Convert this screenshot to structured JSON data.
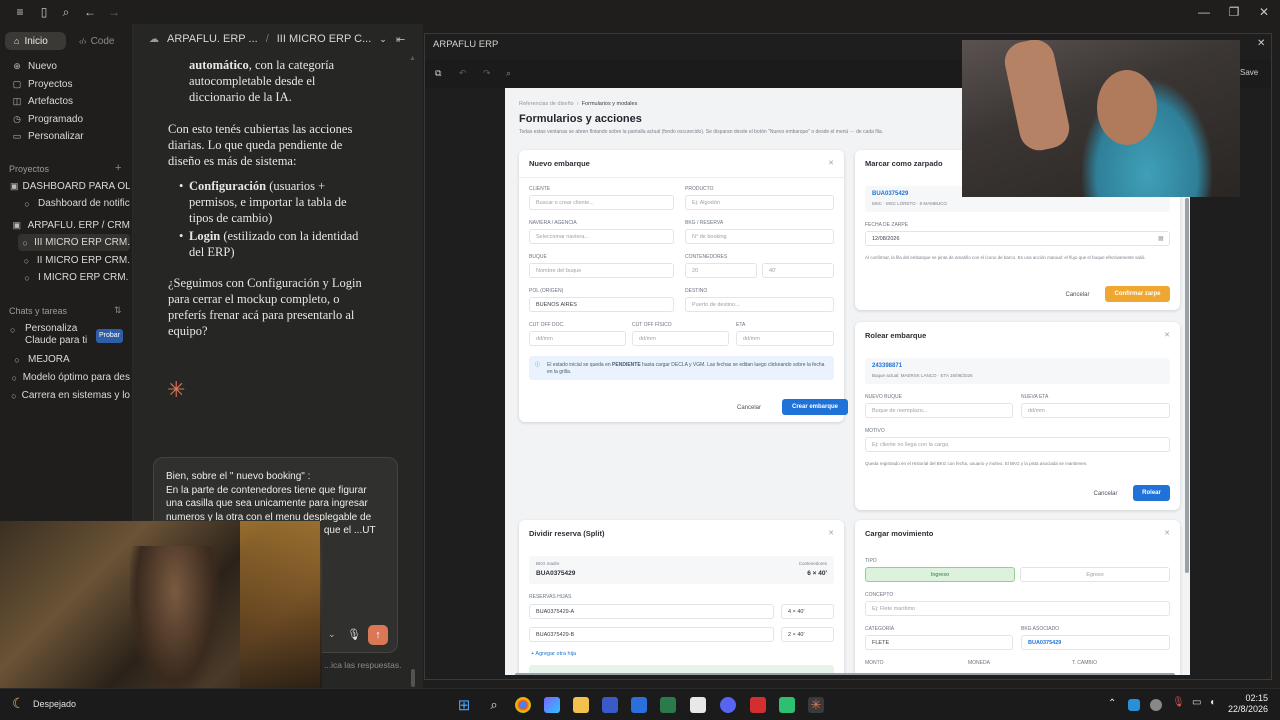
{
  "topbar": {
    "sidebar_toggle": "sidebar-icon",
    "search": "search-icon",
    "back": "←",
    "forward": "→"
  },
  "sidebar": {
    "tabs": {
      "home": "Inicio",
      "code": "Code"
    },
    "nav": [
      "Nuevo",
      "Proyectos",
      "Artefactos",
      "Programado",
      "Personalizar"
    ],
    "projects_title": "Proyectos",
    "projects": [
      "DASHBOARD PARA OLE",
      "Dashboard de notific",
      "ARPAFLU. ERP / CRM",
      "III MICRO ERP CRM.",
      "II MICRO ERP CRM.",
      "I MICRO ERP CRM."
    ],
    "chats_title": "Chats y tareas",
    "chats": [
      "Personaliza Claude para ti",
      "MEJORA",
      "Modelo óptimo para des",
      "Carrera en sistemas y lo"
    ],
    "probar": "Probar"
  },
  "chat": {
    "breadcrumb_a": "ARPAFLU. ERP ...",
    "breadcrumb_sep": "/",
    "breadcrumb_b": "III MICRO ERP C...",
    "p1_bold": "automático",
    "p1_rest": ", con la categoría autocompletable desde el diccionario de la IA.",
    "p2": "Con esto tenés cubiertas las acciones diarias. Lo que queda pendiente de diseño es más de sistema:",
    "b1_bold": "Configuración",
    "b1_rest": " (usuarios + permisos, e importar la tabla de tipos de cambio)",
    "b2_bold": "Login",
    "b2_rest": " (estilizado con la identidad del ERP)",
    "p3": "¿Seguimos con Configuración y Login para cerrar el mockup completo, o preferís frenar acá para presentarlo al equipo?",
    "composer_text": "Bien, sobre el \" nuevo booking\" :\nEn la parte de contenedores tiene que figurar una casilla que sea unicamente para ingresar numeros y la otra con el menu desplegable de ...os a agregar ...o tambien la ...eta que el ...UT OFF ...s tienen que ...ra, bkg,",
    "footer": "...ica las respuestas."
  },
  "window": {
    "title": "ARPAFLU ERP",
    "save": "Save",
    "crumb_a": "Referencias de diseño",
    "crumb_b": "Formularios y modales",
    "page_title": "Formularios y acciones",
    "page_sub": "Todas estas ventanas se abren flotando sobre la pantalla actual (fondo oscurecido). Se disparan desde el botón \"Nuevo embarque\" o desde el menú ··· de cada fila.",
    "nuevo": {
      "title": "Nuevo embarque",
      "cliente": "CLIENTE",
      "cliente_ph": "Buscar o crear cliente...",
      "producto": "PRODUCTO",
      "producto_ph": "Ej: Algodón",
      "naviera": "NAVIERA / AGENCIA",
      "naviera_ph": "Seleccionar naviera...",
      "bkg": "BKG / RESERVA",
      "bkg_ph": "N° de booking",
      "buque": "BUQUE",
      "buque_ph": "Nombre del buque",
      "contenedores": "CONTENEDORES",
      "cont_num": "20",
      "cont_type": "40'",
      "pol": "POL (ORIGEN)",
      "pol_val": "BUENOS AIRES",
      "destino": "DESTINO",
      "destino_ph": "Puerto de destino...",
      "cut_doc": "CUT OFF DOC.",
      "cut_fis": "CUT OFF FÍSICO",
      "eta": "ETA",
      "date_ph": "dd/mm",
      "info_a": "El estado inicial se queda en ",
      "info_bold": "PENDIENTE",
      "info_b": " hasta cargar DECLA y VGM. Las fechas se editan luego clickeando sobre la fecha en la grilla.",
      "cancel": "Cancelar",
      "create": "Crear embarque"
    },
    "zarpado": {
      "title": "Marcar como zarpado",
      "bkg": "BUA0375429",
      "sub": "MSC · MSC LORETO · 6 MAMBUCO",
      "badge": "PARA A AMARILLO",
      "fecha": "FECHA DE ZARPE",
      "fecha_val": "12/08/2026",
      "note": "Al confirmar, la fila del embarque se pinta de amarillo con el ícono de barco. Es una acción manual: el flujo que el buque efectivamente salió.",
      "cancel": "Cancelar",
      "confirm": "Confirmar zarpe"
    },
    "rolear": {
      "title": "Rolear embarque",
      "bkg": "243398871",
      "sub": "Buque actual: MAERSK LANCO · ETA 16/08/2026",
      "nb": "NUEVO BUQUE",
      "nb_ph": "Buque de reemplazo...",
      "ne": "NUEVA ETA",
      "ne_ph": "dd/mm",
      "motivo": "MOTIVO",
      "motivo_ph": "Ej: cliente no llega con la carga",
      "note": "Queda registrado en el Historial del BKG con fecha, usuario y motivo. El BKG y la pista asociada se mantienen.",
      "cancel": "Cancelar",
      "ok": "Rolear"
    },
    "split": {
      "title": "Dividir reserva (Split)",
      "madre": "BKG madre",
      "madre_val": "BUA0375429",
      "cont": "Contenedores",
      "cont_val": "6 × 40'",
      "hijas": "RESERVAS HIJAS",
      "h1": "BUA0375429-A",
      "h1c": "4 × 40'",
      "h2": "BUA0375429-B",
      "h2c": "2 × 40'",
      "add": "+ Agregar otra hija"
    },
    "mov": {
      "title": "Cargar movimiento",
      "tipo": "TIPO",
      "ingreso": "Ingreso",
      "egreso": "Egreso",
      "concepto": "CONCEPTO",
      "concepto_ph": "Ej: Flete marítimo",
      "categoria": "CATEGORÍA",
      "cat_val": "FLETE",
      "bkg": "BKG ASOCIADO",
      "bkg_val": "BUA0375429",
      "monto": "MONTO",
      "moneda": "MONEDA",
      "tcambio": "T. CAMBIO"
    }
  },
  "weather": "Despejado",
  "clock": {
    "time": "02:15",
    "date": "22/8/2026"
  },
  "colors": {
    "accent_orange": "#d97757",
    "blue": "#1f73d8",
    "amber": "#f0a732"
  }
}
